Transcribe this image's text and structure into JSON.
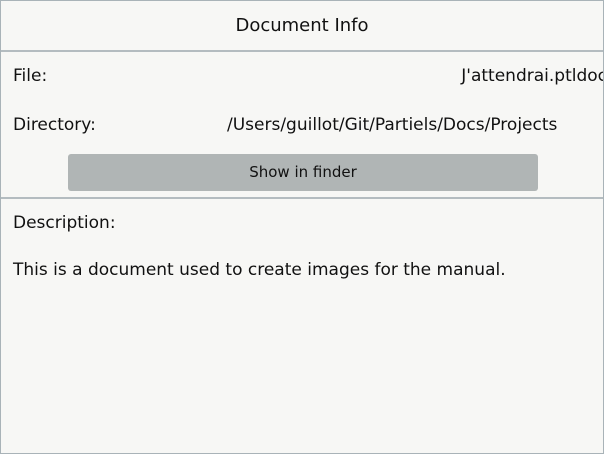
{
  "title": "Document Info",
  "file": {
    "label": "File:",
    "value": "J'attendrai.ptldoc"
  },
  "directory": {
    "label": "Directory:",
    "value": "/Users/guillot/Git/Partiels/Docs/Projects"
  },
  "show_in_finder": "Show in finder",
  "description": {
    "label": "Description:",
    "value": "This is a document used to create images for the manual."
  }
}
